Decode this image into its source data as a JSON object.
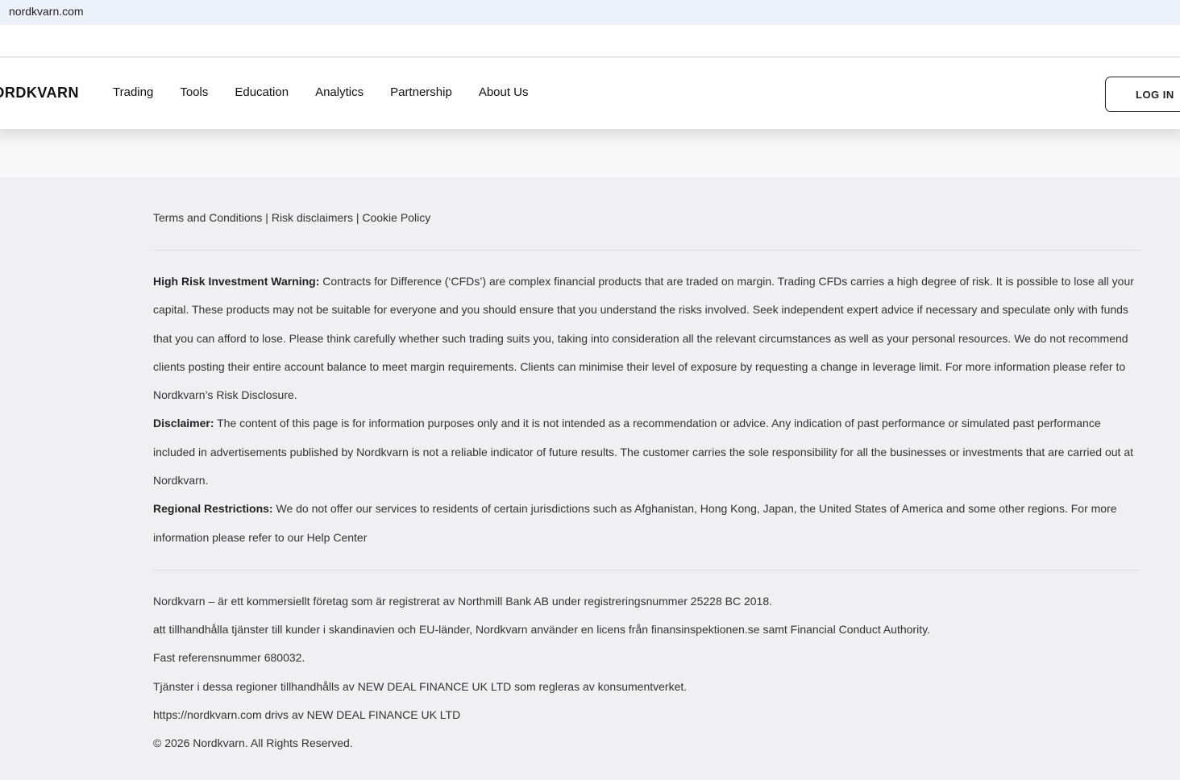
{
  "browser": {
    "url": "nordkvarn.com"
  },
  "nav": {
    "logo": "NORDKVARN",
    "items": [
      "Trading",
      "Tools",
      "Education",
      "Analytics",
      "Partnership",
      "About Us"
    ],
    "login": "LOG IN"
  },
  "footer": {
    "links": [
      "Terms and Conditions",
      "Risk disclaimers",
      "Cookie Policy"
    ],
    "separator": " | ",
    "warning_title": "High Risk Investment Warning:",
    "warning_text": " Contracts for Difference (‘CFDs’) are complex financial products that are traded on margin. Trading CFDs carries a high degree of risk. It is possible to lose all your capital. These products may not be suitable for everyone and you should ensure that you understand the risks involved. Seek independent expert advice if necessary and speculate only with funds that you can afford to lose. Please think carefully whether such trading suits you, taking into consideration all the relevant circumstances as well as your personal resources. We do not recommend clients posting their entire account balance to meet margin requirements. Clients can minimise their level of exposure by requesting a change in leverage limit. For more information please refer to Nordkvarn’s Risk Disclosure.",
    "disclaimer_title": "Disclaimer:",
    "disclaimer_text": " The content of this page is for information purposes only and it is not intended as a recommendation or advice. Any indication of past performance or simulated past performance included in advertisements published by Nordkvarn is not a reliable indicator of future results. The customer carries the sole responsibility for all the businesses or investments that are carried out at Nordkvarn.",
    "regional_title": "Regional Restrictions:",
    "regional_text": " We do not offer our services to residents of certain jurisdictions such as Afghanistan, Hong Kong, Japan, the United States of America and some other regions. For more information please refer to our ",
    "help_center": "Help Center",
    "registration": [
      "Nordkvarn – är ett kommersiellt företag som är registrerat av Northmill Bank AB under registreringsnummer 25228 BC 2018.",
      "att tillhandhålla tjänster till kunder i skandinavien och EU-länder, Nordkvarn använder en licens från finansinspektionen.se samt Financial Conduct Authority.",
      "Fast referensnummer 680032.",
      "Tjänster i dessa regioner tillhandhålls av NEW DEAL FINANCE UK LTD som regleras av konsumentverket.",
      "https://nordkvarn.com drivs av NEW DEAL FINANCE UK LTD",
      "© 2026 Nordkvarn. All Rights Reserved."
    ]
  }
}
